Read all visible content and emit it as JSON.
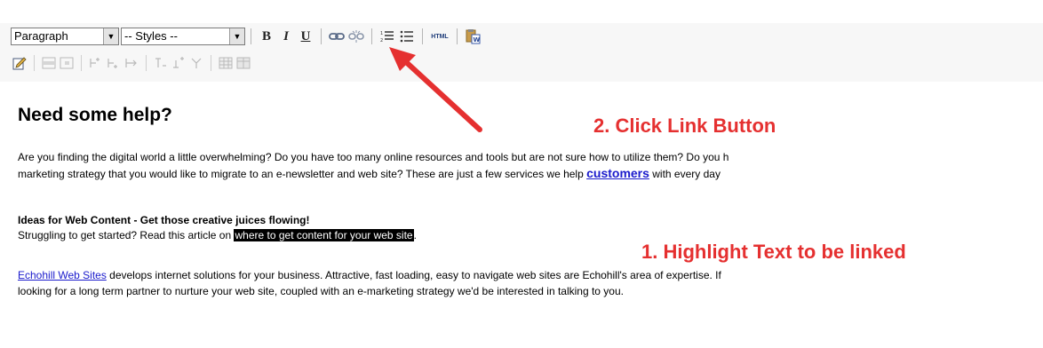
{
  "toolbar": {
    "format_select": "Paragraph",
    "styles_select": "-- Styles --",
    "bold_label": "B",
    "italic_label": "I",
    "underline_label": "U",
    "html_label": "HTML"
  },
  "content": {
    "heading": "Need some help?",
    "intro_line1": "Are you finding the digital world a little overwhelming? Do you have too many online resources and tools but are not sure how to utilize them? Do you h",
    "intro_line2_before": "marketing strategy that you would like to migrate to an e-newsletter and web site? These are just a few services we help ",
    "intro_link": "customers",
    "intro_line2_after": " with every day",
    "ideas_title": "Ideas for Web Content - Get those creative juices flowing!",
    "ideas_before": "Struggling to get started? Read this article on ",
    "ideas_highlight": "where to get content for your web site",
    "ideas_after": ".",
    "echo_link": "Echohill Web Sites",
    "echo_line1_after": " develops internet solutions for your business. Attractive, fast loading, easy to navigate web sites are Echohill's area of expertise. If",
    "echo_line2": "looking for a long term partner to nurture your web site, coupled with an e-marketing strategy we'd be interested in talking to you."
  },
  "annotations": {
    "step2": "2. Click Link Button",
    "step1": "1. Highlight Text to be linked",
    "color": "#e53030"
  }
}
